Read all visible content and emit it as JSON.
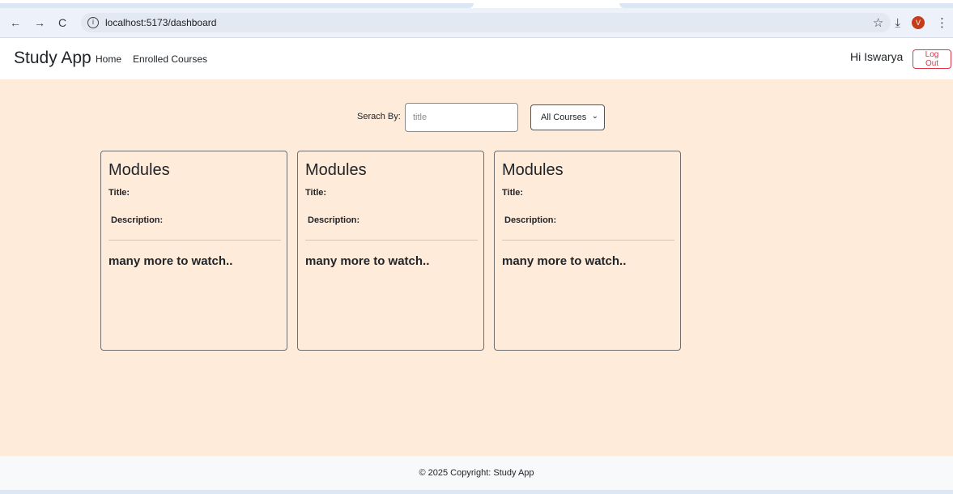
{
  "browser": {
    "url": "localhost:5173/dashboard",
    "back_icon": "←",
    "forward_icon": "→",
    "reload_icon": "C",
    "info_icon": "i",
    "star_icon": "☆",
    "download_icon": "⤓",
    "profile_initial": "V",
    "menu_icon": "⋮"
  },
  "navbar": {
    "brand": "Study App",
    "links": [
      "Home",
      "Enrolled Courses"
    ],
    "greeting": "Hi Iswarya",
    "logout_label": "Log Out"
  },
  "search": {
    "label": "Serach By:",
    "placeholder": "title",
    "value": "",
    "filter_selected": "All Courses",
    "filter_chevron": "⌄"
  },
  "cards": [
    {
      "heading": "Modules",
      "title_label": "Title:",
      "description_label": "Description:",
      "more_text": "many more to watch.."
    },
    {
      "heading": "Modules",
      "title_label": "Title:",
      "description_label": "Description:",
      "more_text": "many more to watch.."
    },
    {
      "heading": "Modules",
      "title_label": "Title:",
      "description_label": "Description:",
      "more_text": "many more to watch.."
    }
  ],
  "footer": {
    "text": "© 2025 Copyright: Study App"
  },
  "colors": {
    "main_background": "#ffebd9",
    "logout_accent": "#dc3545",
    "profile_badge": "#c63c1b"
  }
}
